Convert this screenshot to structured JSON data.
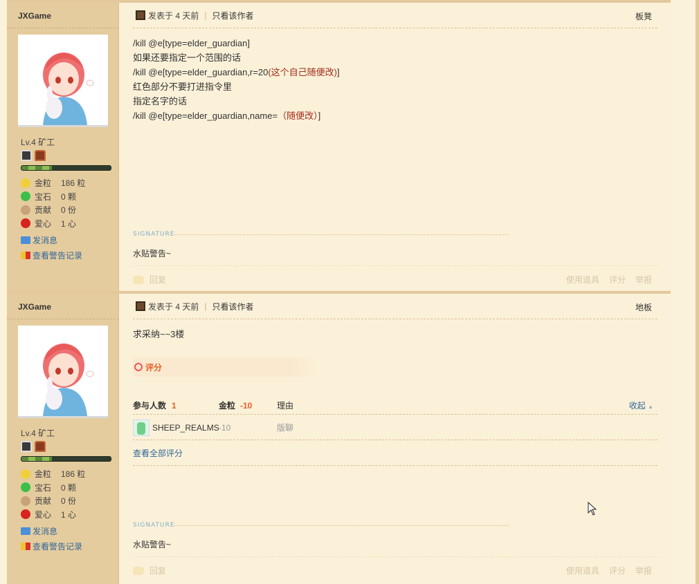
{
  "post1": {
    "author": "JXGame",
    "level": "Lv.4 矿工",
    "stats": [
      {
        "label": "金粒",
        "value": "186 粒"
      },
      {
        "label": "宝石",
        "value": "0 颗"
      },
      {
        "label": "贡献",
        "value": "0 份"
      },
      {
        "label": "爱心",
        "value": "1 心"
      }
    ],
    "send_message": "发消息",
    "view_warnings": "查看警告记录",
    "posted": "发表于 4 天前",
    "sep": "|",
    "only_author": "只看该作者",
    "floor": "板凳",
    "lines": {
      "l1": "/kill @e[type=elder_guardian]",
      "l2": "如果还要指定一个范围的话",
      "l3a": "/kill @e[type=elder_guardian,r=20",
      "l3b": "(这个自己随便改)",
      "l3c": "]",
      "l4": "红色部分不要打进指令里",
      "l5": "指定名字的话",
      "l6a": "/kill @e[type=elder_guardian,name=",
      "l6b": "（随便改）",
      "l6c": "]"
    },
    "signature_label": "SIGNATURE",
    "signature": "水贴警告~",
    "reply": "回复",
    "use_item": "使用道具",
    "rate": "评分",
    "report": "举报"
  },
  "post2": {
    "author": "JXGame",
    "level": "Lv.4 矿工",
    "stats": [
      {
        "label": "金粒",
        "value": "186 粒"
      },
      {
        "label": "宝石",
        "value": "0 颗"
      },
      {
        "label": "贡献",
        "value": "0 份"
      },
      {
        "label": "爱心",
        "value": "1 心"
      }
    ],
    "send_message": "发消息",
    "view_warnings": "查看警告记录",
    "posted": "发表于 4 天前",
    "sep": "|",
    "only_author": "只看该作者",
    "floor": "地板",
    "content": "求采纳~~3楼",
    "rating": {
      "title": "评分",
      "participants_label": "参与人数",
      "participants": "1",
      "gold_label": "金粒",
      "gold": "-10",
      "reason_label": "理由",
      "collapse": "收起",
      "row": {
        "user": "SHEEP_REALMS",
        "gold": "-10",
        "reason": "版聊"
      },
      "view_all": "查看全部评分"
    },
    "signature_label": "SIGNATURE",
    "signature": "水贴警告~",
    "reply": "回复",
    "use_item": "使用道具",
    "rate": "评分",
    "report": "举报"
  },
  "colors": {
    "sidebar": "#e5cc9e",
    "background": "#fbf1d9",
    "link": "#336699",
    "highlight_red": "#a32a1a",
    "rating_orange": "#e55f2a"
  },
  "icons": {
    "stat_icons": [
      "gold-nugget-icon",
      "emerald-icon",
      "contribution-icon",
      "apple-heart-icon"
    ],
    "message_icon": "envelope-icon",
    "warning_icon": "warning-card-icon"
  }
}
